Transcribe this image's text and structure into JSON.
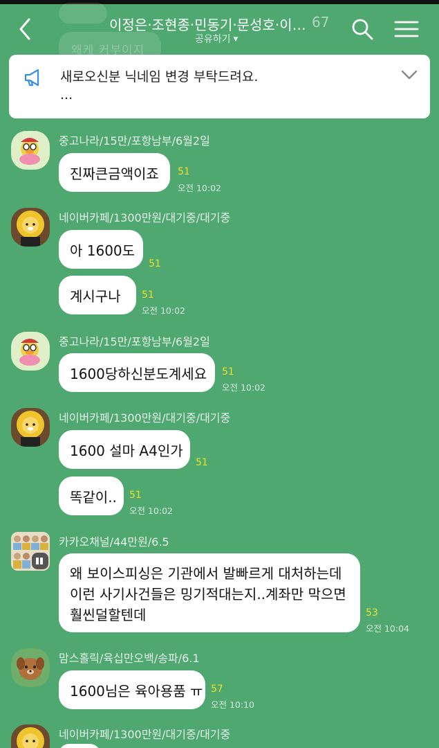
{
  "header": {
    "title": "이정은·조현종·민동기·문성호·이…",
    "member_count": "67",
    "subtitle": "공유하기",
    "back_icon": "chevron-left-icon",
    "search_icon": "search-icon",
    "menu_icon": "hamburger-menu-icon"
  },
  "background_ghost": {
    "text": "왜케 커부이지"
  },
  "notice": {
    "line1": "새로오신분 닉네임 변경 부탁드려요.",
    "line2": "...",
    "icon": "megaphone-icon",
    "expand_icon": "chevron-down-icon"
  },
  "messages": [
    {
      "sender": "중고나라/15만/포항남부/6월2일",
      "avatar": "duck-character",
      "bubbles": [
        {
          "text": "진짜큰금액이죠",
          "unread": "51",
          "time": "오전 10:02"
        }
      ]
    },
    {
      "sender": "네이버카페/1300만원/대기중/대기중",
      "avatar": "lion-character",
      "bubbles": [
        {
          "text": "아 1600도",
          "unread": "51",
          "time": ""
        },
        {
          "text": "계시구나",
          "unread": "51",
          "time": "오전 10:02"
        }
      ]
    },
    {
      "sender": "중고나라/15만/포항남부/6월2일",
      "avatar": "duck-character",
      "bubbles": [
        {
          "text": "1600당하신분도계세요",
          "unread": "51",
          "time": "오전 10:02"
        }
      ]
    },
    {
      "sender": "네이버카페/1300만원/대기중/대기중",
      "avatar": "lion-character",
      "bubbles": [
        {
          "text": "1600 설마 A4인가",
          "unread": "51",
          "time": ""
        },
        {
          "text": "똑같이..",
          "unread": "51",
          "time": "오전 10:02"
        }
      ]
    },
    {
      "sender": "카카오채널/44만원/6.5",
      "avatar": "group-photo",
      "bubbles": [
        {
          "lines": [
            "왜 보이스피싱은 기관에서 발빠르게 대처하는데",
            "이런 사기사건들은 밍기적대는지..계좌만 막으면",
            "훨씬덜할텐데"
          ],
          "unread": "53",
          "time": "오전 10:04"
        }
      ]
    },
    {
      "sender": "맘스홀릭/육십만오백/송파/6.1",
      "avatar": "dog-character",
      "bubbles": [
        {
          "text": "1600님은 육아용품 ㅠ",
          "unread": "57",
          "time": "오전 10:10"
        }
      ]
    },
    {
      "sender": "네이버카페/1300만원/대기중/대기중",
      "avatar": "lion-character",
      "bubbles": []
    }
  ],
  "colors": {
    "background": "#4fa86f",
    "bubble": "#ffffff",
    "unread": "#f1e02a",
    "notice_icon": "#3a8fd8"
  }
}
